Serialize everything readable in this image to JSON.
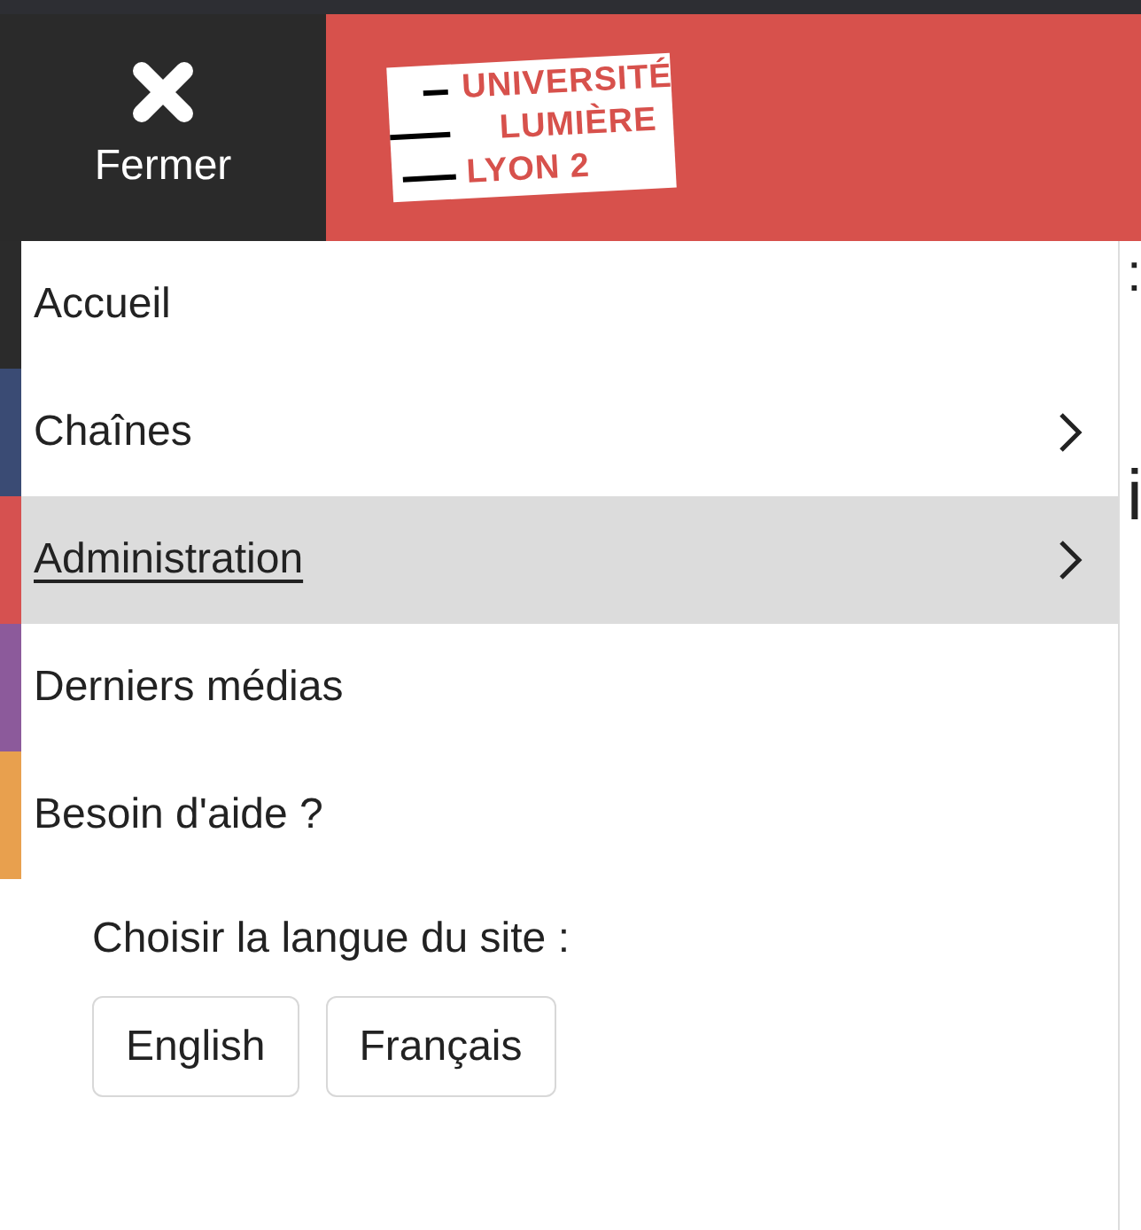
{
  "header": {
    "close_label": "Fermer",
    "logo_lines": [
      "UNIVERSITÉ",
      "LUMIÈRE",
      "LYON 2"
    ]
  },
  "menu": {
    "items": [
      {
        "label": "Accueil",
        "color": "#2b2b2b",
        "has_submenu": false,
        "selected": false
      },
      {
        "label": "Chaînes",
        "color": "#3a4b74",
        "has_submenu": true,
        "selected": false
      },
      {
        "label": "Administration",
        "color": "#d65150",
        "has_submenu": true,
        "selected": true
      },
      {
        "label": "Derniers médias",
        "color": "#8c5a9b",
        "has_submenu": false,
        "selected": false
      },
      {
        "label": "Besoin d'aide ?",
        "color": "#e8a04e",
        "has_submenu": false,
        "selected": false
      }
    ]
  },
  "language": {
    "label": "Choisir la langue du site :",
    "options": [
      "English",
      "Français"
    ]
  },
  "background_fragments": [
    ":",
    "i"
  ]
}
